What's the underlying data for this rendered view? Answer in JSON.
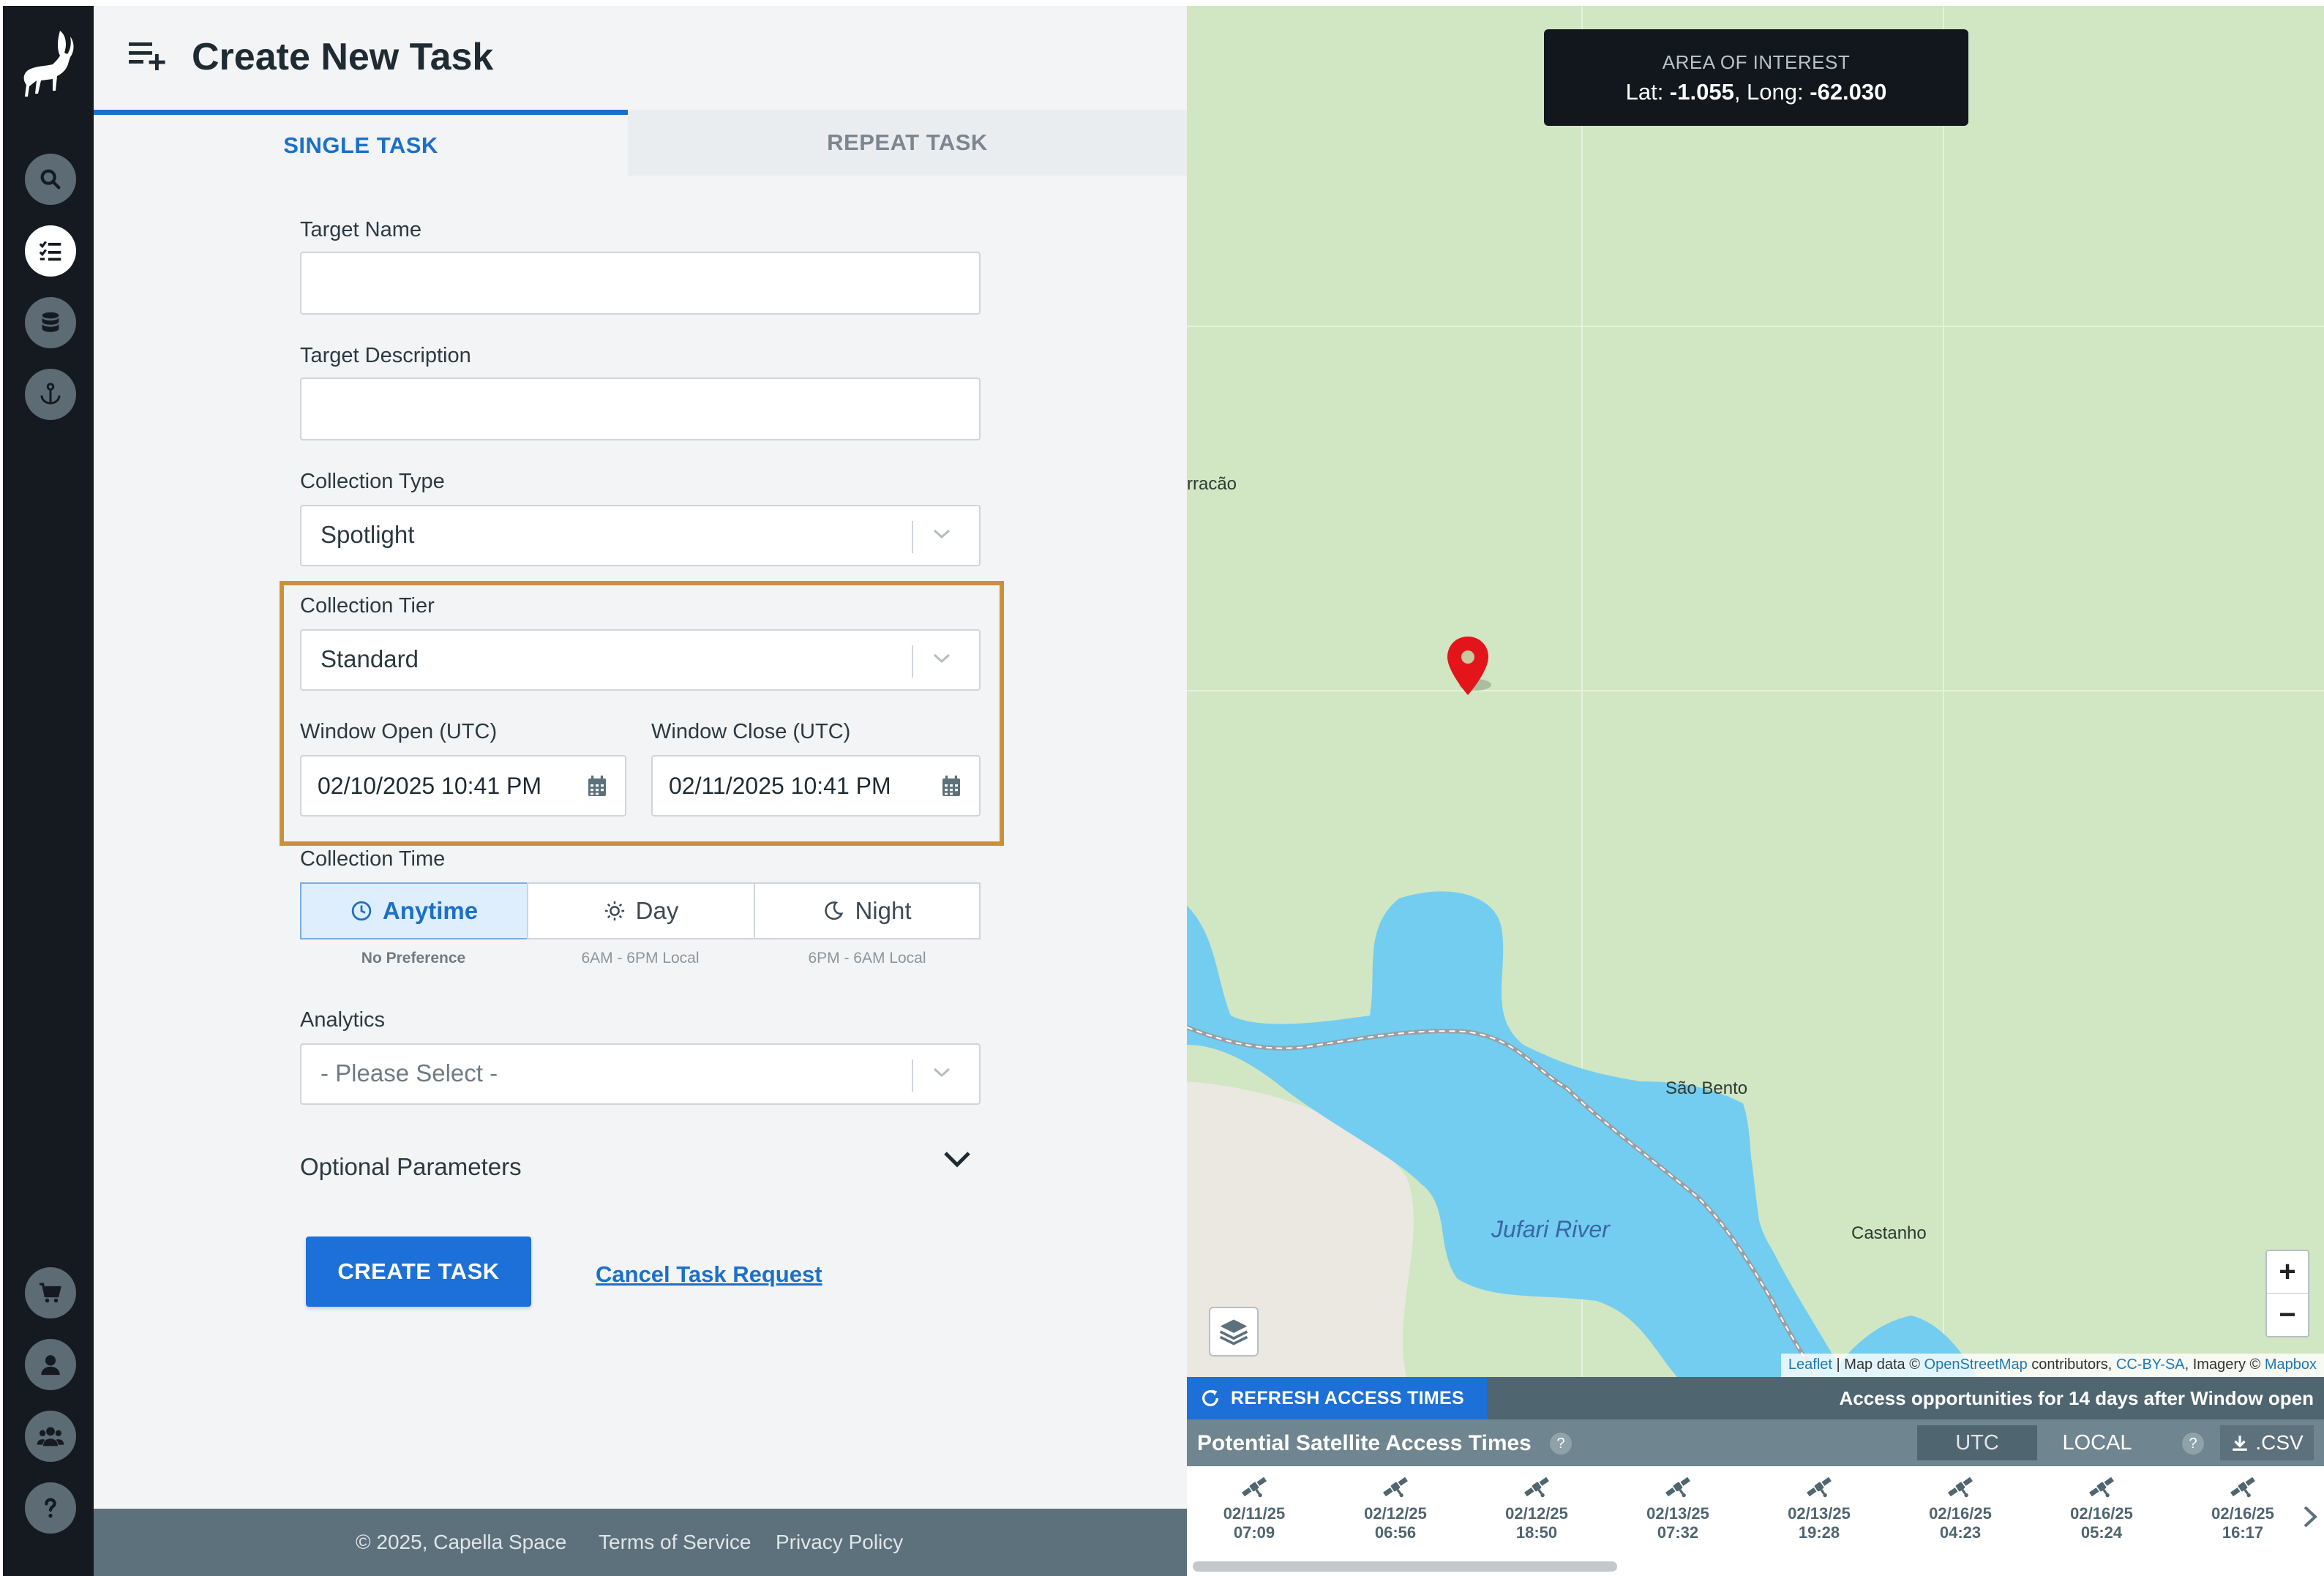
{
  "header": {
    "title": "Create New Task"
  },
  "tabs": {
    "single": "SINGLE TASK",
    "repeat": "REPEAT TASK"
  },
  "form": {
    "target_name_label": "Target Name",
    "target_name_value": "",
    "target_description_label": "Target Description",
    "target_description_value": "",
    "collection_type_label": "Collection Type",
    "collection_type_value": "Spotlight",
    "collection_tier_label": "Collection Tier",
    "collection_tier_value": "Standard",
    "window_open_label": "Window Open (UTC)",
    "window_open_value": "02/10/2025 10:41 PM",
    "window_close_label": "Window Close (UTC)",
    "window_close_value": "02/11/2025 10:41 PM",
    "collection_time_label": "Collection Time",
    "collection_time_options": [
      {
        "label": "Anytime",
        "sub": "No Preference",
        "selected": true
      },
      {
        "label": "Day",
        "sub": "6AM - 6PM Local",
        "selected": false
      },
      {
        "label": "Night",
        "sub": "6PM - 6AM Local",
        "selected": false
      }
    ],
    "analytics_label": "Analytics",
    "analytics_value": "- Please Select -",
    "optional_parameters_label": "Optional Parameters",
    "create_button": "CREATE TASK",
    "cancel_link": "Cancel Task Request"
  },
  "footer": {
    "copyright": "© 2025, Capella Space",
    "terms": "Terms of Service",
    "privacy": "Privacy Policy"
  },
  "map": {
    "aoi_title": "AREA OF INTEREST",
    "lat_label": "Lat: ",
    "lat_value": "-1.055",
    "long_label": ", Long: ",
    "long_value": "-62.030",
    "place_labels": {
      "arracao": "rracão",
      "sao_bento": "São Bento",
      "jufari_river": "Jufari River",
      "castanho": "Castanho"
    },
    "zoom_in": "+",
    "zoom_out": "−",
    "attribution": {
      "leaflet": "Leaflet",
      "sep1": " | Map data © ",
      "osm": "OpenStreetMap",
      "contributors": " contributors, ",
      "license": "CC-BY-SA",
      "imagery": ", Imagery © ",
      "mapbox": "Mapbox"
    },
    "water_color": "#73cdf0",
    "land_color": "#d1e6c3",
    "pin_color": "#e4141b"
  },
  "access": {
    "refresh_button": "REFRESH ACCESS TIMES",
    "note": "Access opportunities for 14 days after Window open",
    "title": "Potential Satellite Access Times",
    "help": "?",
    "tz_utc": "UTC",
    "tz_local": "LOCAL",
    "csv": ".CSV",
    "times": [
      {
        "date": "02/11/25",
        "time": "07:09"
      },
      {
        "date": "02/12/25",
        "time": "06:56"
      },
      {
        "date": "02/12/25",
        "time": "18:50"
      },
      {
        "date": "02/13/25",
        "time": "07:32"
      },
      {
        "date": "02/13/25",
        "time": "19:28"
      },
      {
        "date": "02/16/25",
        "time": "04:23"
      },
      {
        "date": "02/16/25",
        "time": "05:24"
      },
      {
        "date": "02/16/25",
        "time": "16:17"
      }
    ]
  },
  "colors": {
    "accent": "#1c70d8",
    "highlight_border": "#c9913c",
    "sidebar": "#141a20"
  }
}
